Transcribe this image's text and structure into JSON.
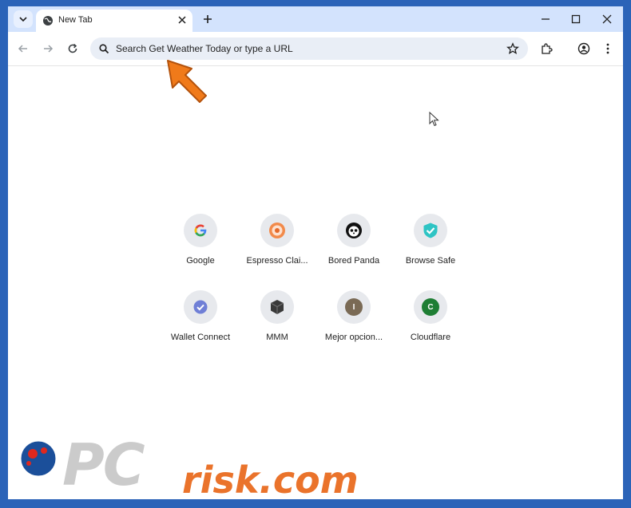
{
  "tab": {
    "title": "New Tab"
  },
  "omnibox": {
    "placeholder": "Search Get Weather Today or type a URL"
  },
  "shortcuts": [
    {
      "label": "Google",
      "icon": "google-icon"
    },
    {
      "label": "Espresso Clai...",
      "icon": "espresso-icon"
    },
    {
      "label": "Bored Panda",
      "icon": "panda-icon"
    },
    {
      "label": "Browse Safe",
      "icon": "shield-check-icon",
      "color": "#2ec4c4"
    },
    {
      "label": "Wallet Connect",
      "icon": "check-icon",
      "color": "#6f7fd6"
    },
    {
      "label": "MMM",
      "icon": "cube-icon",
      "color": "#3a3a3a"
    },
    {
      "label": "Mejor opcion...",
      "letter": "I",
      "color": "#7a6a55"
    },
    {
      "label": "Cloudflare",
      "letter": "C",
      "color": "#1e7e34"
    }
  ],
  "watermark": {
    "pc": "PC",
    "risk": "risk.com"
  },
  "colors": {
    "frame": "#2b63b8",
    "tabstrip": "#d3e3fd",
    "accent_arrow": "#f07a1a"
  }
}
